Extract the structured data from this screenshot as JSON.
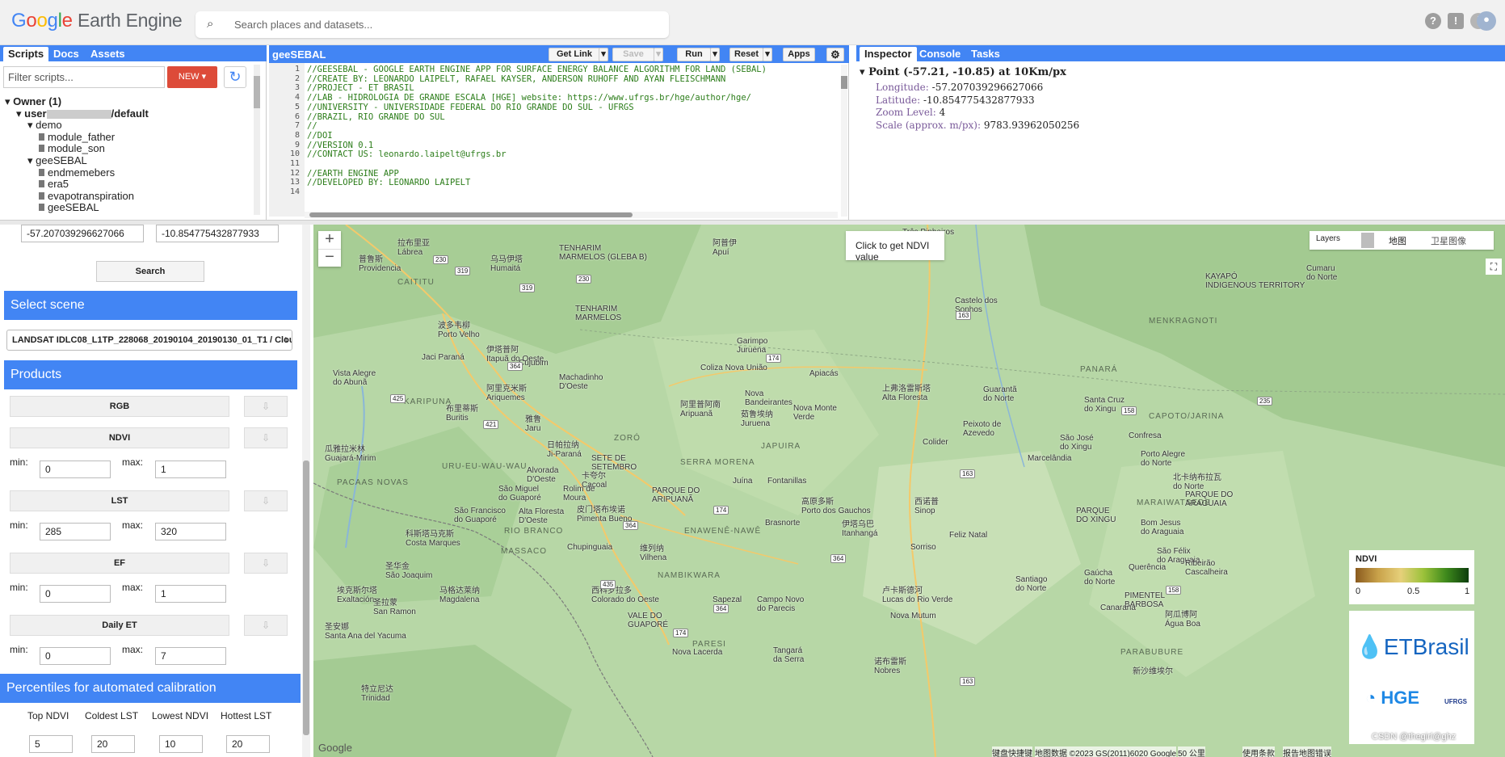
{
  "header": {
    "logo_google": [
      "G",
      "o",
      "o",
      "g",
      "l",
      "e"
    ],
    "logo_product": "Earth Engine",
    "search_placeholder": "Search places and datasets..."
  },
  "left_tabs": [
    "Scripts",
    "Docs",
    "Assets"
  ],
  "scripts": {
    "filter_placeholder": "Filter scripts...",
    "new_label": "NEW ▾",
    "tree": [
      {
        "label": "Owner (1)",
        "bold": true,
        "indent": 0,
        "caret": "▾"
      },
      {
        "label": "user",
        "suffix": "/default",
        "bold": true,
        "indent": 1,
        "caret": "▾"
      },
      {
        "label": "demo",
        "indent": 2,
        "caret": "▾"
      },
      {
        "label": "module_father",
        "indent": 3,
        "doc": true
      },
      {
        "label": "module_son",
        "indent": 3,
        "doc": true
      },
      {
        "label": "geeSEBAL",
        "indent": 2,
        "caret": "▾"
      },
      {
        "label": "endmemebers",
        "indent": 3,
        "doc": true
      },
      {
        "label": "era5",
        "indent": 3,
        "doc": true
      },
      {
        "label": "evapotranspiration",
        "indent": 3,
        "doc": true
      },
      {
        "label": "geeSEBAL",
        "indent": 3,
        "doc": true
      }
    ]
  },
  "editor": {
    "title": "geeSEBAL",
    "buttons": [
      "Get Link",
      "Save",
      "Run",
      "Reset",
      "Apps"
    ],
    "lines": [
      "//GEESEBAL - GOOGLE EARTH ENGINE APP FOR SURFACE ENERGY BALANCE ALGORITHM FOR LAND (SEBAL)",
      "//CREATE BY: LEONARDO LAIPELT, RAFAEL KAYSER, ANDERSON RUHOFF AND AYAN FLEISCHMANN",
      "//PROJECT - ET BRASIL",
      "//LAB - HIDROLOGIA DE GRANDE ESCALA [HGE] website: https://www.ufrgs.br/hge/author/hge/",
      "//UNIVERSITY - UNIVERSIDADE FEDERAL DO RIO GRANDE DO SUL - UFRGS",
      "//BRAZIL, RIO GRANDE DO SUL",
      "//",
      "//DOI",
      "//VERSION 0.1",
      "//CONTACT US: leonardo.laipelt@ufrgs.br",
      "",
      "//EARTH ENGINE APP",
      "//DEVELOPED BY: LEONARDO LAIPELT",
      "14"
    ]
  },
  "right_tabs": [
    "Inspector",
    "Console",
    "Tasks"
  ],
  "inspector": {
    "point": "Point (-57.21, -10.85) at 10Km/px",
    "rows": [
      {
        "key": "Longitude:",
        "val": "-57.207039296627066"
      },
      {
        "key": "Latitude:",
        "val": "-10.854775432877933"
      },
      {
        "key": "Zoom Level:",
        "val": "4"
      },
      {
        "key": "Scale (approx. m/px):",
        "val": "9783.93962050256"
      }
    ]
  },
  "ui": {
    "lon": "-57.207039296627066",
    "lat": "-10.854775432877933",
    "search_btn": "Search",
    "select_scene": "Select scene",
    "scene_value": "LANDSAT IDLC08_L1TP_228068_20190104_20190130_01_T1 / Clou",
    "products": "Products",
    "rgb": "RGB",
    "ndvi": "NDVI",
    "lst": "LST",
    "ef": "EF",
    "daily_et": "Daily ET",
    "min_label": "min:",
    "max_label": "max:",
    "ndvi_min": "0",
    "ndvi_max": "1",
    "lst_min": "285",
    "lst_max": "320",
    "ef_min": "0",
    "ef_max": "1",
    "et_min": "0",
    "et_max": "7",
    "percentiles_title": "Percentiles for automated calibration",
    "pct_labels": [
      "Top NDVI",
      "Coldest LST",
      "Lowest NDVI",
      "Hottest LST"
    ],
    "pct_values": [
      "5",
      "20",
      "10",
      "20"
    ]
  },
  "map": {
    "click_hint": "Click to get NDVI value",
    "layers": "Layers",
    "map_btn": "地图",
    "sat_btn": "卫星图像",
    "legend_title": "NDVI",
    "legend_ticks": [
      "0",
      "0.5",
      "1"
    ],
    "legend_colors": [
      "#8a5a1e",
      "#c9a24a",
      "#e6d07a",
      "#9bc23a",
      "#3f8a1c",
      "#0c3d0c"
    ],
    "logo_et": "ETBrasil",
    "logo_hge": "HGE",
    "logo_ufrgs": "UFRGS",
    "footer": [
      "键盘快捷键",
      "地图数据 ©2023 GS(2011)6020 Google",
      "50 公里",
      "使用条款",
      "报告地图错误"
    ],
    "watermark": "CSDN @thegirl@ghz",
    "places": [
      [
        "拉布里亚",
        "Lábrea",
        90,
        10
      ],
      [
        "普鲁斯",
        "Providencia",
        42,
        30
      ],
      [
        "乌马伊塔",
        "Humaitá",
        205,
        30
      ],
      [
        "TENHARIM",
        "MARMELOS (GLEBA B)",
        290,
        20
      ],
      [
        "阿普伊",
        "Apuí",
        480,
        10
      ],
      [
        "Três Pinheiros",
        "",
        715,
        0
      ],
      [
        "CAITITU",
        "",
        90,
        62
      ],
      [
        "TENHARIM",
        "MARMELOS",
        310,
        95
      ],
      [
        "波多韦柳",
        "Porto Velho",
        140,
        112
      ],
      [
        "伊塔普阿",
        "Itapuã do Oeste",
        200,
        142
      ],
      [
        "Garimpo",
        "Juruena",
        510,
        135
      ],
      [
        "Castelo dos",
        "Sonhos",
        780,
        85
      ],
      [
        "MENKRAGNOTI",
        "",
        1020,
        110
      ],
      [
        "KAYAPÓ",
        "INDIGENOUS TERRITORY",
        1090,
        55
      ],
      [
        "Cumaru",
        "do Norte",
        1215,
        45
      ],
      [
        "Jaci Paraná",
        "",
        120,
        155
      ],
      [
        "Cujubim",
        "",
        240,
        162
      ],
      [
        "Machadinho",
        "D'Oeste",
        290,
        180
      ],
      [
        "Coliza Nova União",
        "",
        465,
        168
      ],
      [
        "Apiacás",
        "",
        600,
        175
      ],
      [
        "PANARÁ",
        "",
        935,
        170
      ],
      [
        "Vista Alegre",
        "do Abunã",
        10,
        175
      ],
      [
        "阿里克米斯",
        "Ariquemes",
        200,
        190
      ],
      [
        "上弗洛雷斯塔",
        "Alta Floresta",
        690,
        190
      ],
      [
        "Guarantã",
        "do Norte",
        815,
        195
      ],
      [
        "Nova",
        "Bandeirantes",
        520,
        200
      ],
      [
        "阿里普阿南",
        "Aripuanã",
        440,
        210
      ],
      [
        "KARIPUNA",
        "",
        98,
        210
      ],
      [
        "布里蒂斯",
        "Buritis",
        150,
        215
      ],
      [
        "茹鲁埃纳",
        "Juruena",
        515,
        222
      ],
      [
        "Nova Monte",
        "Verde",
        580,
        218
      ],
      [
        "Santa Cruz",
        "do Xingu",
        940,
        208
      ],
      [
        "CAPOTO/JARINA",
        "",
        1020,
        228
      ],
      [
        "雅鲁",
        "Jaru",
        248,
        228
      ],
      [
        "Peixoto de",
        "Azevedo",
        790,
        238
      ],
      [
        "瓜雅拉米林",
        "Guajará-Mirim",
        0,
        265
      ],
      [
        "日帕拉纳",
        "Ji-Paraná",
        275,
        260
      ],
      [
        "ZORÓ",
        "",
        358,
        255
      ],
      [
        "Colider",
        "",
        740,
        260
      ],
      [
        "Marcelândia",
        "",
        870,
        280
      ],
      [
        "São José",
        "do Xingu",
        910,
        255
      ],
      [
        "Confresa",
        "",
        995,
        252
      ],
      [
        "URU-EU-WAU-WAU",
        "",
        145,
        290
      ],
      [
        "SETE DE",
        "SETEMBRO",
        330,
        280
      ],
      [
        "SERRA MORENA",
        "",
        440,
        285
      ],
      [
        "JAPUIRA",
        "",
        540,
        265
      ],
      [
        "Alvorada",
        "D'Oeste",
        250,
        295
      ],
      [
        "卡夸尔",
        "Cacoal",
        318,
        298
      ],
      [
        "Juína",
        "",
        505,
        308
      ],
      [
        "Fontanillas",
        "",
        548,
        308
      ],
      [
        "Porto Alegre",
        "do Norte",
        1010,
        275
      ],
      [
        "São Miguel",
        "do Guaporé",
        215,
        318
      ],
      [
        "Rolim de",
        "Moura",
        295,
        318
      ],
      [
        "PARQUE DO",
        "ARIPUANÃ",
        405,
        320
      ],
      [
        "高原多斯",
        "Porto dos Gauchos",
        590,
        330
      ],
      [
        "西诺普",
        "Sinop",
        730,
        330
      ],
      [
        "北卡纳布拉瓦",
        "do Norte",
        1050,
        300
      ],
      [
        "PACAAS NOVAS",
        "",
        15,
        310
      ],
      [
        "São Francisco",
        "do Guaporé",
        160,
        345
      ],
      [
        "Alta Floresta",
        "D'Oeste",
        240,
        346
      ],
      [
        "皮门塔布埃诺",
        "Pimenta Bueno",
        312,
        340
      ],
      [
        "Brasnorte",
        "",
        545,
        360
      ],
      [
        "伊塔乌巴",
        "Itanhangá",
        640,
        358
      ],
      [
        "PARQUE",
        "DO XINGU",
        930,
        345
      ],
      [
        "PARQUE DO",
        "ARAGUAIA",
        1065,
        325
      ],
      [
        "科斯塔马克斯",
        "Costa Marques",
        100,
        370
      ],
      [
        "RIO BRANCO",
        "",
        222,
        370
      ],
      [
        "ENAWENÊ-NAWÊ",
        "",
        445,
        370
      ],
      [
        "Feliz Natal",
        "",
        773,
        375
      ],
      [
        "MARAIWATSEDE",
        "",
        1005,
        335
      ],
      [
        "Bom Jesus",
        "do Araguaia",
        1010,
        360
      ],
      [
        "Chupinguaia",
        "",
        300,
        390
      ],
      [
        "维列纳",
        "Vilhena",
        390,
        388
      ],
      [
        "MASSACO",
        "",
        218,
        395
      ],
      [
        "Sorriso",
        "",
        725,
        390
      ],
      [
        "São Félix",
        "do Araguaia",
        1030,
        395
      ],
      [
        "圣华金",
        "São Joaquim",
        75,
        410
      ],
      [
        "NAMBIKWARA",
        "",
        412,
        425
      ],
      [
        "Querência",
        "",
        995,
        415
      ],
      [
        "马格达莱纳",
        "Magdalena",
        142,
        440
      ],
      [
        "西科罗拉多",
        "Colorado do Oeste",
        330,
        440
      ],
      [
        "埃克斯尔塔",
        "Exaltación",
        15,
        440
      ],
      [
        "Santiago",
        "do Norte",
        855,
        430
      ],
      [
        "Gaúcha",
        "do Norte",
        940,
        422
      ],
      [
        "Ribeirão",
        "Cascalheira",
        1065,
        410
      ],
      [
        "Sapezal",
        "",
        480,
        455
      ],
      [
        "Campo Novo",
        "do Parecis",
        535,
        455
      ],
      [
        "卢卡斯德河",
        "Lucas do Rio Verde",
        690,
        440
      ],
      [
        "圣拉蒙",
        "San Ramon",
        60,
        455
      ],
      [
        "阿瓜博阿",
        "Água Boa",
        1040,
        470
      ],
      [
        "Nova Mutum",
        "",
        700,
        475
      ],
      [
        "PIMENTEL",
        "BARBOSA",
        990,
        450
      ],
      [
        "Canarana",
        "",
        960,
        465
      ],
      [
        "VALE DO",
        "GUAPORÉ",
        375,
        475
      ],
      [
        "圣安娜",
        "Santa Ana del Yacuma",
        0,
        485
      ],
      [
        "PARESI",
        "",
        455,
        510
      ],
      [
        "Nova Lacerda",
        "",
        430,
        520
      ],
      [
        "Tangará",
        "da Serra",
        555,
        518
      ],
      [
        "诺布雷斯",
        "Nobres",
        680,
        528
      ],
      [
        "PARABUBURE",
        "",
        985,
        520
      ],
      [
        "特立尼达",
        "Trinidad",
        45,
        562
      ],
      [
        "新沙维埃尔",
        "",
        1000,
        540
      ]
    ]
  }
}
